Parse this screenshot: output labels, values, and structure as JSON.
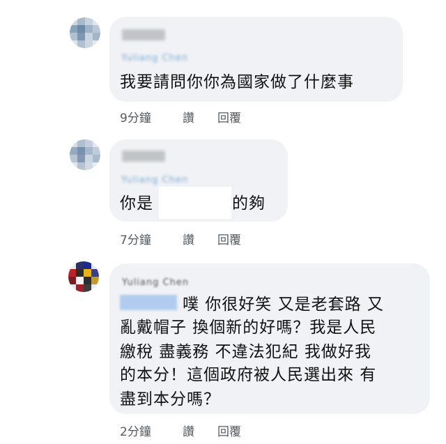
{
  "comments": [
    {
      "author_name": "",
      "tag_name": "Yuliang Chen",
      "text": "我要請問你你為國家做了什麼事",
      "time": "9分鐘",
      "like_label": "讚",
      "reply_label": "回覆",
      "avatar_icon": "blurred-avatar-icon"
    },
    {
      "author_name": "",
      "tag_name": "Yuliang Chen",
      "text_before": "你是",
      "text_after": "的夠",
      "time": "7分鐘",
      "like_label": "讚",
      "reply_label": "回覆",
      "avatar_icon": "blurred-avatar-icon"
    },
    {
      "author_name": "Yuliang Chen",
      "lines": [
        "噗 你很好笑 又是老套路 又",
        "亂戴帽子 換個新的好嗎？我是人民",
        "繳稅 盡義務 不違法犯紀 我做好我",
        "的本分！這個政府被人民選出來 有",
        "盡到本分嗎？"
      ],
      "time": "2分鐘",
      "like_label": "讚",
      "reply_label": "回覆",
      "avatar_icon": "colorful-avatar-icon"
    }
  ],
  "colors": {
    "bubble": "#f0f2f5",
    "text": "#111111",
    "meta": "#555a60",
    "tag": "#aecbee"
  }
}
